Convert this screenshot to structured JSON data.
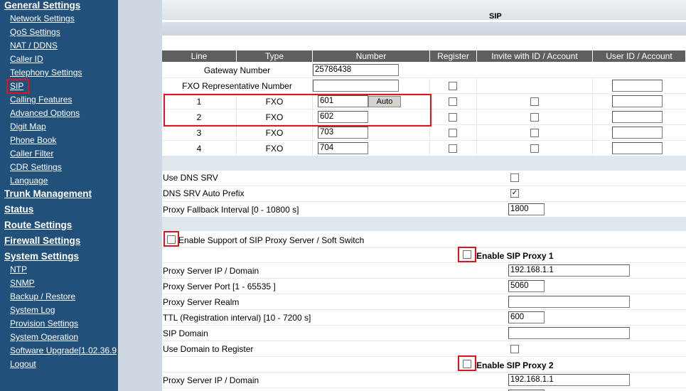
{
  "sidebar": {
    "general": "General Settings",
    "general_items": [
      "Network Settings",
      "QoS Settings",
      "NAT / DDNS",
      "Caller ID",
      "Telephony Settings",
      "SIP",
      "Calling Features",
      "Advanced Options",
      "Digit Map",
      "Phone Book",
      "Caller Filter",
      "CDR Settings",
      "Language"
    ],
    "trunk": "Trunk Management",
    "status": "Status",
    "route": "Route Settings",
    "firewall": "Firewall Settings",
    "system": "System Settings",
    "system_items": [
      "NTP",
      "SNMP",
      "Backup / Restore",
      "System Log",
      "Provision Settings",
      "System Operation",
      "Software Upgrade[1.02.36.9",
      "Logout"
    ],
    "active_item": "SIP"
  },
  "page_title": "SIP",
  "table": {
    "headers": [
      "Line",
      "Type",
      "Number",
      "Register",
      "Invite with ID / Account",
      "User ID / Account"
    ],
    "gateway_label": "Gateway Number",
    "gateway_value": "25786438",
    "fxo_rep_label": "FXO Representative Number",
    "fxo_rep_value": "",
    "auto_button": "Auto",
    "rows": [
      {
        "line": "1",
        "type": "FXO",
        "number": "601"
      },
      {
        "line": "2",
        "type": "FXO",
        "number": "602"
      },
      {
        "line": "3",
        "type": "FXO",
        "number": "703"
      },
      {
        "line": "4",
        "type": "FXO",
        "number": "704"
      }
    ]
  },
  "dns": {
    "use_dns_srv_label": "Use DNS SRV",
    "use_dns_srv_checked": false,
    "auto_prefix_label": "DNS SRV Auto Prefix",
    "auto_prefix_checked": true,
    "fallback_label": "Proxy Fallback Interval [0 - 10800 s]",
    "fallback_value": "1800"
  },
  "proxy": {
    "enable_support_label": "Enable Support of SIP Proxy Server / Soft Switch",
    "enable_proxy1_label": "Enable SIP Proxy 1",
    "enable_proxy2_label": "Enable SIP Proxy 2",
    "server_ip_label": "Proxy Server IP / Domain",
    "server_ip_value": "192.168.1.1",
    "server_port_label": "Proxy Server Port [1 - 65535 ]",
    "server_port_value": "5060",
    "realm_label": "Proxy Server Realm",
    "realm_value": "",
    "ttl_label": "TTL (Registration interval) [10 - 7200 s]",
    "ttl_value": "600",
    "sip_domain_label": "SIP Domain",
    "sip_domain_value": "",
    "use_domain_label": "Use Domain to Register",
    "server_ip2_label": "Proxy Server IP / Domain",
    "server_ip2_value": "192.168.1.1"
  },
  "colors": {
    "sidebar_bg": "#21517a",
    "header_bg": "#5c6063",
    "highlight_red": "#e0141c"
  }
}
